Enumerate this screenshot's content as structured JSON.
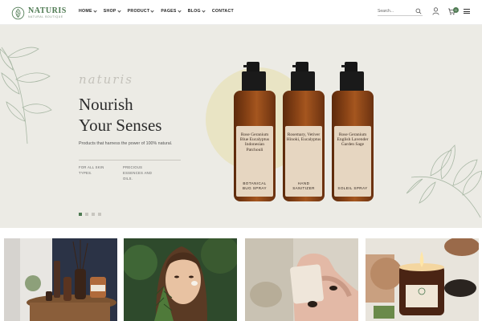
{
  "header": {
    "brand_name": "NATURIS",
    "brand_tagline": "NATURAL BOUTIQUE",
    "nav": [
      {
        "label": "HOME",
        "has_dropdown": true
      },
      {
        "label": "SHOP",
        "has_dropdown": true
      },
      {
        "label": "PRODUCT",
        "has_dropdown": true
      },
      {
        "label": "PAGES",
        "has_dropdown": true
      },
      {
        "label": "BLOG",
        "has_dropdown": true
      },
      {
        "label": "CONTACT",
        "has_dropdown": false
      }
    ],
    "search_placeholder": "Search...",
    "cart_count": "0",
    "icons": [
      "search-icon",
      "user-icon",
      "cart-icon",
      "menu-icon"
    ]
  },
  "hero": {
    "script_text": "naturis",
    "headline_line1": "Nourish",
    "headline_line2": "Your Senses",
    "subline": "Products that harness the power of 100% natural.",
    "bullets": [
      {
        "text": "FOR ALL SKIN TYPES."
      },
      {
        "text": "PRECIOUS ESSENCES AND OILS."
      }
    ],
    "bottles": [
      {
        "top_lines": [
          "Rose Geranium",
          "Blue Eucalyptus",
          "Indonesian Patchouli"
        ],
        "bottom_lines": [
          "BOTANICAL",
          "BUG SPRAY"
        ]
      },
      {
        "top_lines": [
          "Rosemary, Vetiver",
          "Hinoki, Eucalyptus"
        ],
        "bottom_lines": [
          "HAND",
          "SANITIZER"
        ]
      },
      {
        "top_lines": [
          "Rose Geranium",
          "English Lavender",
          "Garden Sage"
        ],
        "bottom_lines": [
          "SOLEIL SPRAY"
        ]
      }
    ],
    "slider": {
      "total": 4,
      "active": 1
    }
  },
  "colors": {
    "brand_green": "#4e7a52",
    "hero_bg": "#ecebe5",
    "amber_glass": "#8b4416"
  }
}
